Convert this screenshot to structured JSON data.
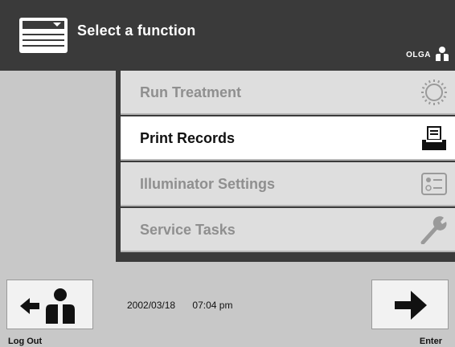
{
  "header": {
    "title": "Select a function",
    "user_name": "OLGA"
  },
  "menu": {
    "items": [
      {
        "label": "Run Treatment",
        "icon": "sun-icon",
        "state": "disabled"
      },
      {
        "label": "Print Records",
        "icon": "printer-icon",
        "state": "selected"
      },
      {
        "label": "Illuminator Settings",
        "icon": "settings-list-icon",
        "state": "disabled"
      },
      {
        "label": "Service Tasks",
        "icon": "wrench-icon",
        "state": "disabled"
      }
    ]
  },
  "footer": {
    "logout_label": "Log Out",
    "enter_label": "Enter",
    "date": "2002/03/18",
    "time": "07:04 pm"
  },
  "colors": {
    "header_bg": "#3a3a3a",
    "panel_bg": "#c8c8c8",
    "selected_bg": "#ffffff",
    "disabled_text": "#8f8f8f"
  }
}
